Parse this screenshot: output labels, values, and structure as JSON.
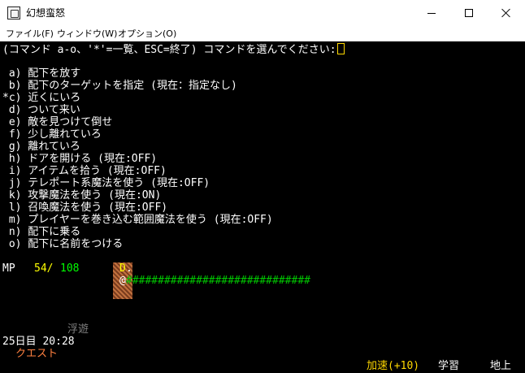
{
  "window": {
    "title": "幻想蛮怒"
  },
  "menubar": {
    "file": "ファイル(F)",
    "window": "ウィンドウ(W)",
    "options": "オプション(O)"
  },
  "terminal": {
    "prompt": "(コマンド a-o、'*'=一覧、ESC=終了) コマンドを選んでください:",
    "commands": [
      " a) 配下を放す",
      " b) 配下のターゲットを指定 (現在：指定なし)",
      "*c) 近くにいろ",
      " d) ついて来い",
      " e) 敵を見つけて倒せ",
      " f) 少し離れていろ",
      " g) 離れていろ",
      " h) ドアを開ける (現在:OFF)",
      " i) アイテムを拾う (現在:OFF)",
      " j) テレポート系魔法を使う (現在:OFF)",
      " k) 攻撃魔法を使う (現在:ON)",
      " l) 召喚魔法を使う (現在:OFF)",
      " m) プレイヤーを巻き込む範囲魔法を使う (現在:OFF)",
      " n) 配下に乗る",
      " o) 配下に名前をつける"
    ]
  },
  "status": {
    "mp_label": "MP",
    "mp_current": "54/",
    "mp_max": "108",
    "floating": "浮遊",
    "date_time": "25日目 20:28",
    "quest": "クエスト",
    "speed": "加速(+10)",
    "study": "学習",
    "ground": "地上"
  },
  "map": {
    "monster": "D",
    "floor": ".",
    "player": "@",
    "wall_run": "#############################"
  },
  "colors": {
    "terminal_bg": "#000000",
    "mp_current": "#ffff00",
    "mp_max": "#00ff00",
    "quest": "#ff8040",
    "speed": "#ffd700",
    "floating": "#808080"
  }
}
